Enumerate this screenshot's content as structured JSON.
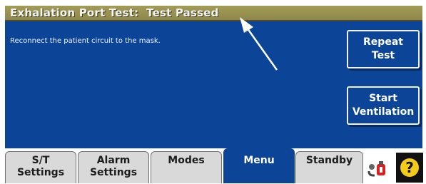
{
  "header": {
    "title": "Exhalation Port Test:  Test Passed"
  },
  "main": {
    "message": "Reconnect the patient circuit to the mask."
  },
  "actions": {
    "repeat_test": [
      "Repeat",
      "Test"
    ],
    "start_ventilation": [
      "Start",
      "Ventilation"
    ]
  },
  "tabs": [
    {
      "lines": [
        "S/T",
        "Settings"
      ],
      "active": false
    },
    {
      "lines": [
        "Alarm",
        "Settings"
      ],
      "active": false
    },
    {
      "lines": [
        "Modes"
      ],
      "active": false
    },
    {
      "lines": [
        "Menu"
      ],
      "active": true
    },
    {
      "lines": [
        "Standby"
      ],
      "active": false
    }
  ],
  "help": {
    "glyph": "?"
  },
  "icons": {
    "status": "patient-circuit-icon",
    "help": "help-icon",
    "pointer": "arrow-pointer"
  },
  "colors": {
    "screen_blue": "#0c4598",
    "title_bar": "#9a9350",
    "tab_gray": "#d9d9d9",
    "help_yellow": "#f3cc1a"
  }
}
